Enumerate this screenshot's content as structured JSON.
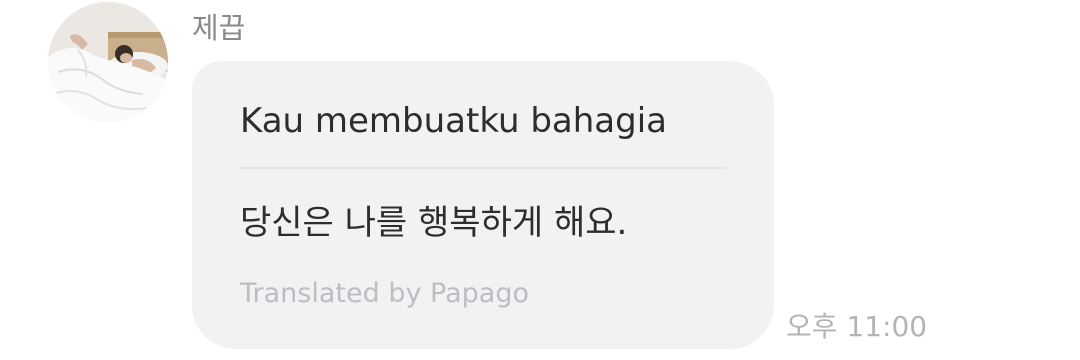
{
  "message": {
    "sender_name": "제끕",
    "original_text": "Kau membuatku bahagia",
    "translated_text": "당신은 나를 행복하게 해요.",
    "attribution": "Translated by Papago",
    "timestamp": "오후 11:00"
  },
  "avatar": {
    "icon": "profile-photo"
  },
  "colors": {
    "bubble": "#f2f2f4",
    "text": "#2d2d2d",
    "secondary_text": "#8a8a8a",
    "attribution": "#bdbdc2",
    "timestamp": "#b4b4b4",
    "divider": "#e3e3e6"
  }
}
